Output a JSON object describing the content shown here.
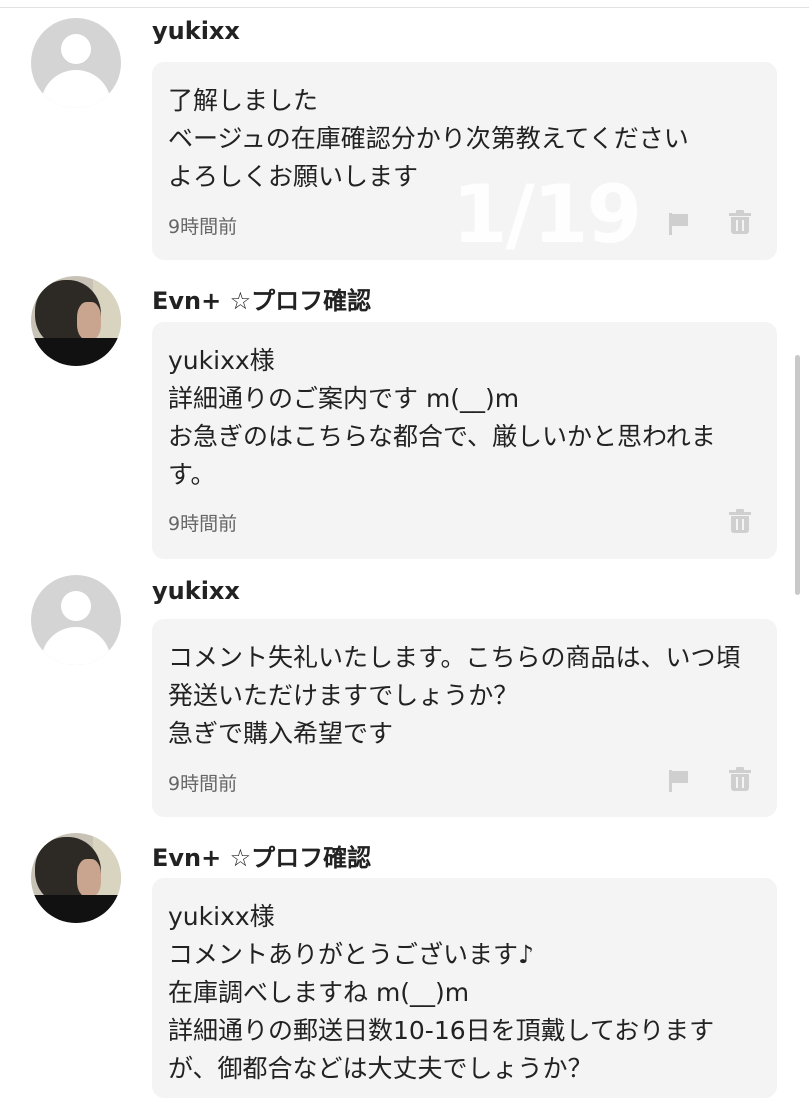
{
  "page_indicator": "1/19",
  "comments": [
    {
      "author": "yukixx",
      "avatar": "default-user-icon",
      "text": "了解しました\nベージュの在庫確認分かり次第教えてください\nよろしくお願いします",
      "time": "9時間前",
      "has_flag": true
    },
    {
      "author": "Evn+ ☆プロフ確認",
      "avatar": "photo",
      "text": "yukixx様\n詳細通りのご案内です m(__)m\nお急ぎのはこちらな都合で、厳しいかと思われます。",
      "time": "9時間前",
      "has_flag": false
    },
    {
      "author": "yukixx",
      "avatar": "default-user-icon",
      "text": "コメント失礼いたします。こちらの商品は、いつ頃発送いただけますでしょうか？\n急ぎで購入希望です",
      "time": "9時間前",
      "has_flag": true
    },
    {
      "author": "Evn+ ☆プロフ確認",
      "avatar": "photo",
      "text": "yukixx様\nコメントありがとうございます♪\n在庫調べしますね m(__)m\n詳細通りの郵送日数10-16日を頂戴しておりますが、御都合などは大丈夫でしょうか？",
      "time": "",
      "has_flag": false
    }
  ]
}
